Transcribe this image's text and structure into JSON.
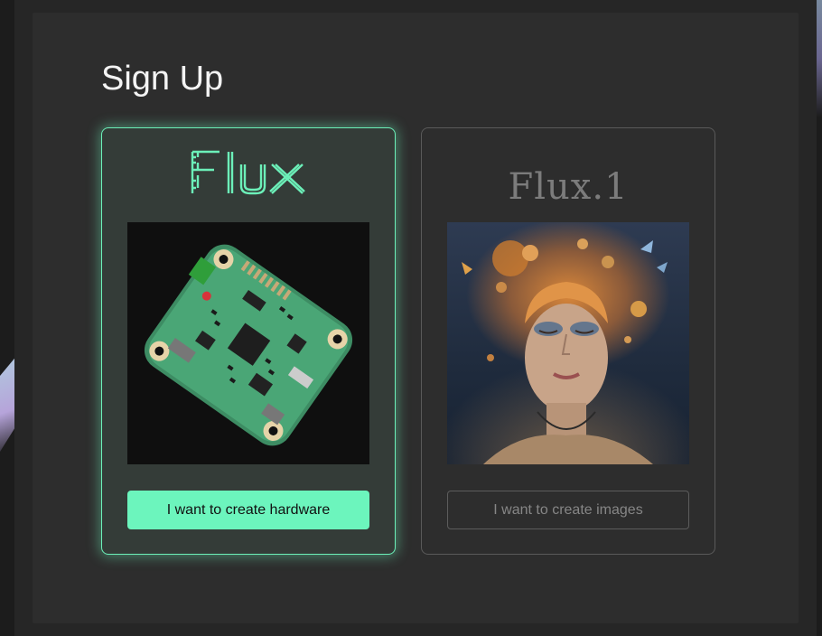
{
  "page": {
    "title": "Sign Up"
  },
  "cards": [
    {
      "id": "hardware",
      "logo_text": "Flux",
      "button_label": "I want to create hardware",
      "selected": true,
      "accent": "#6cf5bd"
    },
    {
      "id": "images",
      "logo_text": "Flux.1",
      "button_label": "I want to create images",
      "selected": false,
      "accent": "#7c7c7c"
    }
  ]
}
